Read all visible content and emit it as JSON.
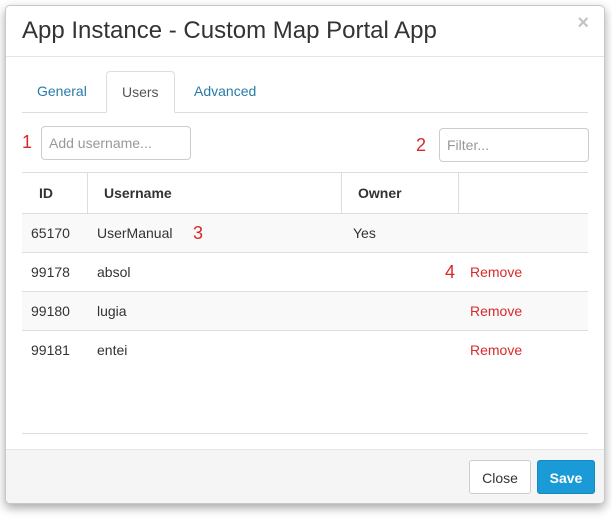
{
  "dialog": {
    "title": "App Instance - Custom Map Portal App",
    "close_glyph": "×"
  },
  "tabs": [
    {
      "label": "General",
      "active": false
    },
    {
      "label": "Users",
      "active": true
    },
    {
      "label": "Advanced",
      "active": false
    }
  ],
  "annotations": [
    "1",
    "2",
    "3",
    "4"
  ],
  "add_user": {
    "placeholder": "Add username...",
    "value": ""
  },
  "filter": {
    "placeholder": "Filter...",
    "value": ""
  },
  "table": {
    "headers": {
      "id": "ID",
      "username": "Username",
      "owner": "Owner",
      "action": ""
    },
    "rows": [
      {
        "id": "65170",
        "username": "UserManual",
        "owner": "Yes",
        "action": ""
      },
      {
        "id": "99178",
        "username": "absol",
        "owner": "",
        "action": "Remove"
      },
      {
        "id": "99180",
        "username": "lugia",
        "owner": "",
        "action": "Remove"
      },
      {
        "id": "99181",
        "username": "entei",
        "owner": "",
        "action": "Remove"
      }
    ]
  },
  "footer": {
    "close_label": "Close",
    "save_label": "Save"
  },
  "colors": {
    "accent": "#1a9ad6",
    "link": "#2a7aa8",
    "danger": "#d62a2a",
    "annotation": "#d62a2a"
  },
  "icons": {
    "close": "close-icon"
  }
}
